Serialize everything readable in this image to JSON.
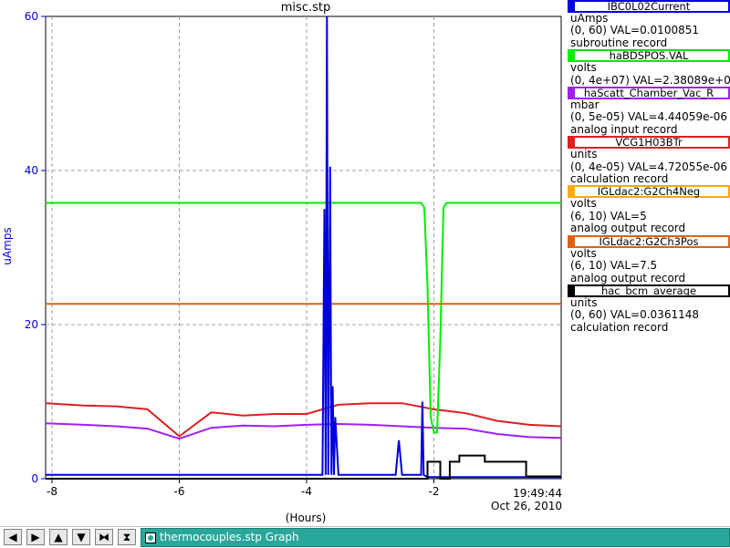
{
  "window": {
    "title": "misc.stp"
  },
  "chart_data": {
    "type": "line",
    "title": "misc.stp",
    "xlabel": "(Hours)",
    "ylabel": "uAmps",
    "xlim": [
      -8.1,
      0
    ],
    "ylim": [
      0,
      60
    ],
    "x_ticks": [
      -8,
      -6,
      -4,
      -2
    ],
    "x_tick_labels": [
      "-8",
      "-6",
      "-4",
      "-2"
    ],
    "y_ticks": [
      0,
      20,
      40,
      60
    ],
    "y_tick_labels": [
      "0",
      "20",
      "40",
      "60"
    ],
    "end_time": "19:49:44",
    "end_date": "Oct 26, 2010",
    "grid": true,
    "legend_position": "right",
    "series": [
      {
        "name": "IBC0L02Current",
        "units": "uAmps",
        "range": "(0, 60)",
        "value": "VAL=0.0100851",
        "record": "subroutine record",
        "color": "#0000dd",
        "x": [
          -8.1,
          -3.75,
          -3.72,
          -3.7,
          -3.68,
          -3.66,
          -3.63,
          -3.61,
          -3.59,
          -3.57,
          -3.55,
          -3.5,
          -2.6,
          -2.55,
          -2.5,
          -2.2,
          -2.18,
          -2.16,
          -2.1,
          -0.6,
          0
        ],
        "y": [
          0.5,
          0.5,
          35,
          0.5,
          60,
          0.5,
          40.5,
          0.5,
          12,
          0.5,
          8,
          0.5,
          0.5,
          5,
          0.5,
          0.5,
          10,
          0.5,
          0.2,
          0.2,
          0.2
        ]
      },
      {
        "name": "haBDSPOS.VAL",
        "units": "volts",
        "range": "(0, 4e+07)",
        "value": "VAL=2.38089e+07",
        "record": "",
        "color": "#00ee00",
        "x": [
          -8.1,
          -2.2,
          -2.15,
          -2.1,
          -2.05,
          -2.0,
          -1.95,
          -1.9,
          -1.85,
          -1.8,
          0
        ],
        "y": [
          35.8,
          35.8,
          35.2,
          25,
          8,
          6,
          6,
          18,
          35.2,
          35.8,
          35.8
        ]
      },
      {
        "name": "haScatt_Chamber_Vac_R",
        "units": "mbar",
        "range": "(0, 5e-05)",
        "value": "VAL=4.44059e-06",
        "record": "analog input record",
        "color": "#a020f0",
        "x": [
          -8.1,
          -7.5,
          -7.0,
          -6.5,
          -6.0,
          -5.5,
          -5.0,
          -4.5,
          -4.0,
          -3.5,
          -3.0,
          -2.5,
          -2.0,
          -1.5,
          -1.0,
          -0.5,
          0
        ],
        "y": [
          7.2,
          7.0,
          6.8,
          6.5,
          5.2,
          6.6,
          6.9,
          6.8,
          7.0,
          7.1,
          7.0,
          6.8,
          6.6,
          6.5,
          5.8,
          5.4,
          5.3
        ]
      },
      {
        "name": "VCG1H03BTr",
        "units": "units",
        "range": "(0, 4e-05)",
        "value": "VAL=4.72055e-06",
        "record": "calculation record",
        "color": "#dd2020",
        "x": [
          -8.1,
          -7.5,
          -7.0,
          -6.5,
          -6.0,
          -5.5,
          -5.0,
          -4.5,
          -4.0,
          -3.5,
          -3.0,
          -2.5,
          -2.0,
          -1.5,
          -1.0,
          -0.5,
          0
        ],
        "y": [
          9.8,
          9.5,
          9.4,
          9.0,
          5.5,
          8.6,
          8.2,
          8.4,
          8.4,
          9.6,
          9.8,
          9.8,
          9.0,
          8.5,
          7.5,
          7.0,
          6.8
        ]
      },
      {
        "name": "IGLdac2:G2Ch4Neg",
        "units": "volts",
        "range": "(6, 10)",
        "value": "VAL=5",
        "record": "analog output record",
        "color": "#ffaa00",
        "x": [
          -8.1,
          0
        ],
        "y": [
          -1,
          -1
        ]
      },
      {
        "name": "IGLdac2:G2Ch3Pos",
        "units": "volts",
        "range": "(6, 10)",
        "value": "VAL=7.5",
        "record": "analog output record",
        "color": "#e06010",
        "x": [
          -8.1,
          0
        ],
        "y": [
          22.7,
          22.7
        ]
      },
      {
        "name": "hac_bcm_average",
        "units": "units",
        "range": "(0, 60)",
        "value": "VAL=0.0361148",
        "record": "calculation record",
        "color": "#000000",
        "x": [
          -8.1,
          -2.1,
          -2.1,
          -1.9,
          -1.9,
          -1.75,
          -1.75,
          -1.6,
          -1.6,
          -1.2,
          -1.2,
          -0.55,
          -0.55,
          0
        ],
        "y": [
          0,
          0,
          2.2,
          2.2,
          0,
          0,
          2.2,
          2.2,
          3,
          3,
          2.2,
          2.2,
          0.3,
          0.3
        ]
      }
    ]
  },
  "taskbar": {
    "window_label": "thermocouples.stp Graph",
    "buttons": [
      {
        "name": "left-arrow",
        "glyph": "◀"
      },
      {
        "name": "right-arrow",
        "glyph": "▶"
      },
      {
        "name": "up-arrow",
        "glyph": "▲"
      },
      {
        "name": "down-arrow",
        "glyph": "▼"
      },
      {
        "name": "zoom-in",
        "glyph": "⧓"
      },
      {
        "name": "zoom-out",
        "glyph": "⧗"
      }
    ]
  }
}
